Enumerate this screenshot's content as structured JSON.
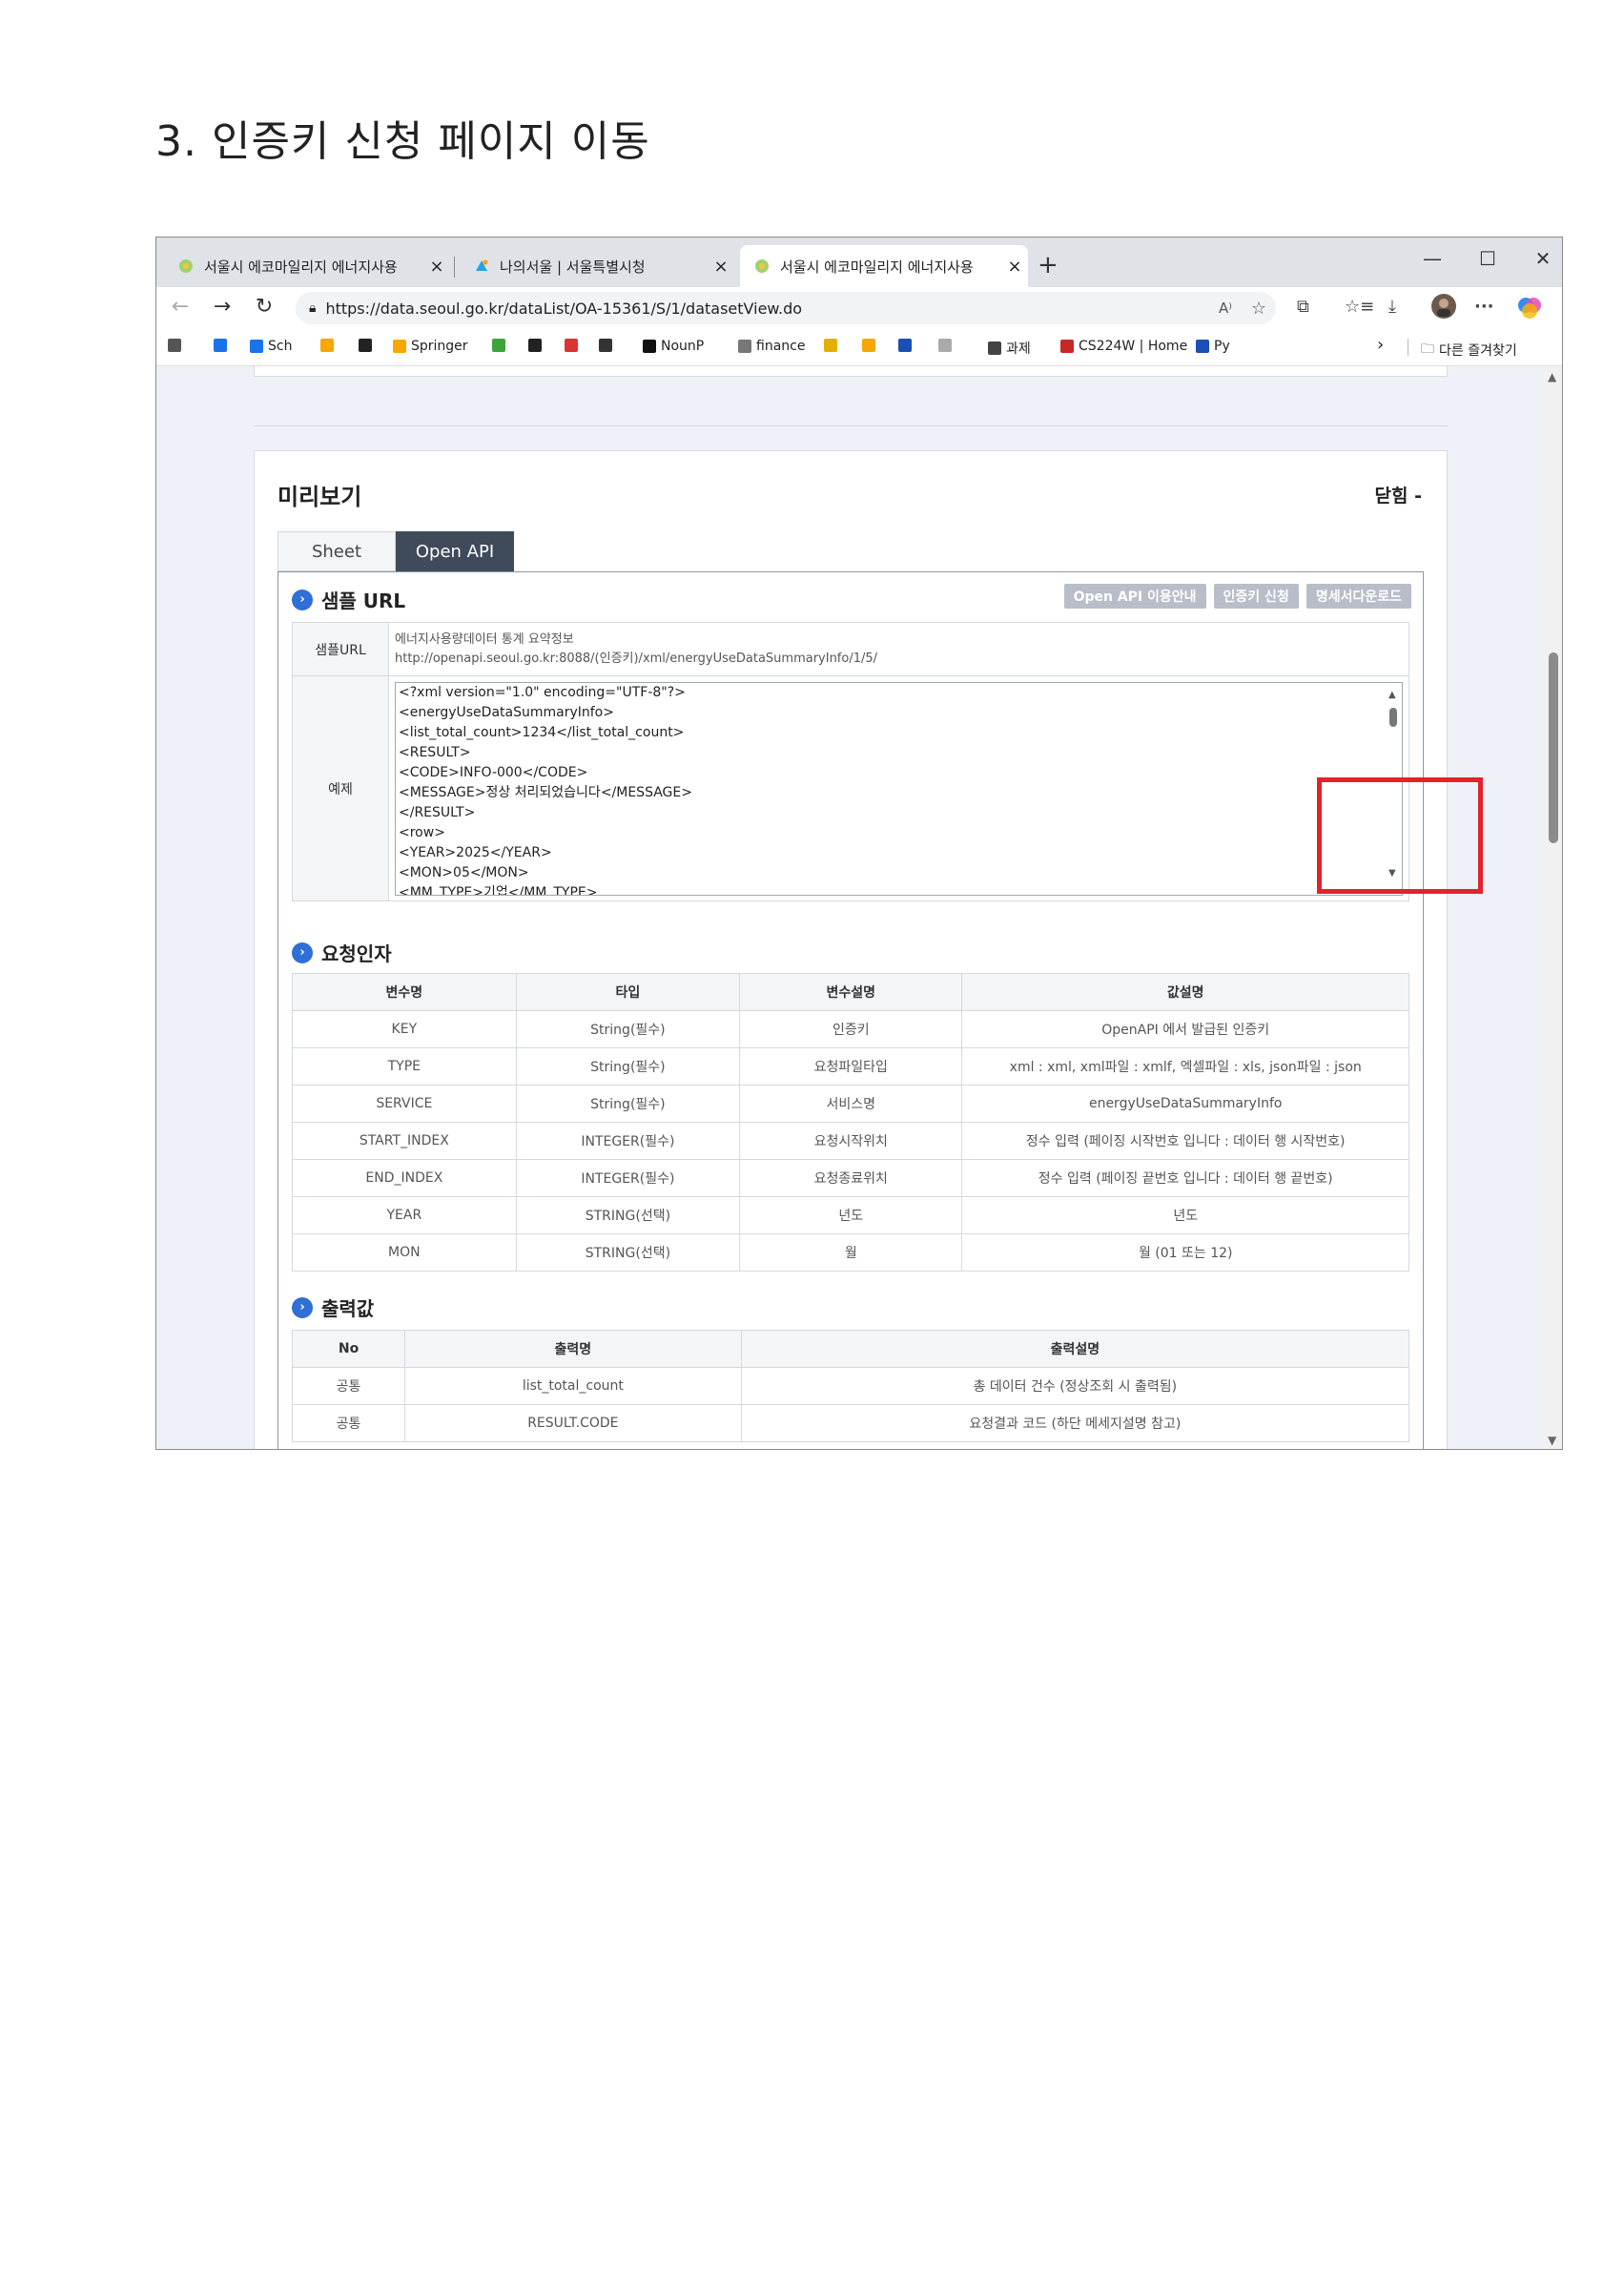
{
  "doc": {
    "title": "3. 인증키 신청 페이지 이동"
  },
  "browser": {
    "tabs": [
      {
        "label": "서울시 에코마일리지 에너지사용",
        "close": "×"
      },
      {
        "label": "나의서울 | 서울특별시청",
        "close": "×"
      },
      {
        "label": "서울시 에코마일리지 에너지사용",
        "close": "×"
      }
    ],
    "new_tab": "+",
    "window": {
      "minimize": "—",
      "maximize": "☐",
      "close": "✕"
    },
    "nav": {
      "back": "←",
      "forward": "→",
      "reload": "↻"
    },
    "url": "https://data.seoul.go.kr/dataList/OA-15361/S/1/datasetView.do",
    "toolbar_icons": {
      "read_aloud": "A⁾",
      "favorite": "☆",
      "extensions": "⧉",
      "favorites_bar": "☆≡",
      "downloads": "⤓",
      "more": "···"
    },
    "bookmarks": [
      {
        "label": "",
        "color": "#555555"
      },
      {
        "label": "",
        "color": "#1a73e8"
      },
      {
        "label": "Sch",
        "color": "#1a73e8"
      },
      {
        "label": "",
        "color": "#f6a700"
      },
      {
        "label": "",
        "color": "#222222"
      },
      {
        "label": "Springer",
        "color": "#f6a700"
      },
      {
        "label": "",
        "color": "#3aa53a"
      },
      {
        "label": "",
        "color": "#222222"
      },
      {
        "label": "",
        "color": "#d33"
      },
      {
        "label": "",
        "color": "#333"
      },
      {
        "label": "NounP",
        "color": "#111111"
      },
      {
        "label": "finance",
        "color": "#777777"
      },
      {
        "label": "",
        "color": "#e3b000"
      },
      {
        "label": "",
        "color": "#f6a700"
      },
      {
        "label": "",
        "color": "#1a4fb3"
      },
      {
        "label": "",
        "color": "#aaaaaa"
      },
      {
        "label": "과제",
        "color": "#444444"
      },
      {
        "label": "CS224W | Home",
        "color": "#c62828"
      },
      {
        "label": "Py",
        "color": "#1a4fb3"
      }
    ],
    "bookmarks_more": "›",
    "other_favorites": "다른 즐겨찾기"
  },
  "preview": {
    "title": "미리보기",
    "close_label": "닫힘 -",
    "tabs": [
      "Sheet",
      "Open API"
    ],
    "sample_url": {
      "heading": "샘플 URL",
      "buttons": [
        "Open API 이용안내",
        "인증키 신청",
        "명세서다운로드"
      ],
      "row_label": "샘플URL",
      "line1": "에너지사용량데이터 통계 요약정보",
      "line2": "http://openapi.seoul.go.kr:8088/(인증키)/xml/energyUseDataSummaryInfo/1/5/",
      "example_label": "예제",
      "code_lines": [
        "<?xml version=\"1.0\" encoding=\"UTF-8\"?>",
        "<energyUseDataSummaryInfo>",
        "<list_total_count>1234</list_total_count>",
        "<RESULT>",
        "<CODE>INFO-000</CODE>",
        "<MESSAGE>정상 처리되었습니다</MESSAGE>",
        "</RESULT>",
        "<row>",
        "<YEAR>2025</YEAR>",
        "<MON>05</MON>",
        "<MM_TYPE>기업</MM_TYPE>"
      ]
    },
    "request": {
      "heading": "요청인자",
      "columns": [
        "변수명",
        "타입",
        "변수설명",
        "값설명"
      ],
      "rows": [
        [
          "KEY",
          "String(필수)",
          "인증키",
          "OpenAPI 에서 발급된 인증키"
        ],
        [
          "TYPE",
          "String(필수)",
          "요청파일타입",
          "xml : xml, xml파일 : xmlf, 엑셀파일 : xls, json파일 : json"
        ],
        [
          "SERVICE",
          "String(필수)",
          "서비스명",
          "energyUseDataSummaryInfo"
        ],
        [
          "START_INDEX",
          "INTEGER(필수)",
          "요청시작위치",
          "정수 입력 (페이징 시작번호 입니다 : 데이터 행 시작번호)"
        ],
        [
          "END_INDEX",
          "INTEGER(필수)",
          "요청종료위치",
          "정수 입력 (페이징 끝번호 입니다 : 데이터 행 끝번호)"
        ],
        [
          "YEAR",
          "STRING(선택)",
          "년도",
          "년도"
        ],
        [
          "MON",
          "STRING(선택)",
          "월",
          "월 (01 또는 12)"
        ]
      ]
    },
    "output": {
      "heading": "출력값",
      "columns": [
        "No",
        "출력명",
        "출력설명"
      ],
      "rows": [
        [
          "공통",
          "list_total_count",
          "총 데이터 건수 (정상조회 시 출력됨)"
        ],
        [
          "공통",
          "RESULT.CODE",
          "요청결과 코드 (하단 메세지설명 참고)"
        ]
      ]
    }
  },
  "colors": {
    "highlight": "#e4222a",
    "accent": "#2f6fd6",
    "active_tab": "#3f4a5a"
  }
}
